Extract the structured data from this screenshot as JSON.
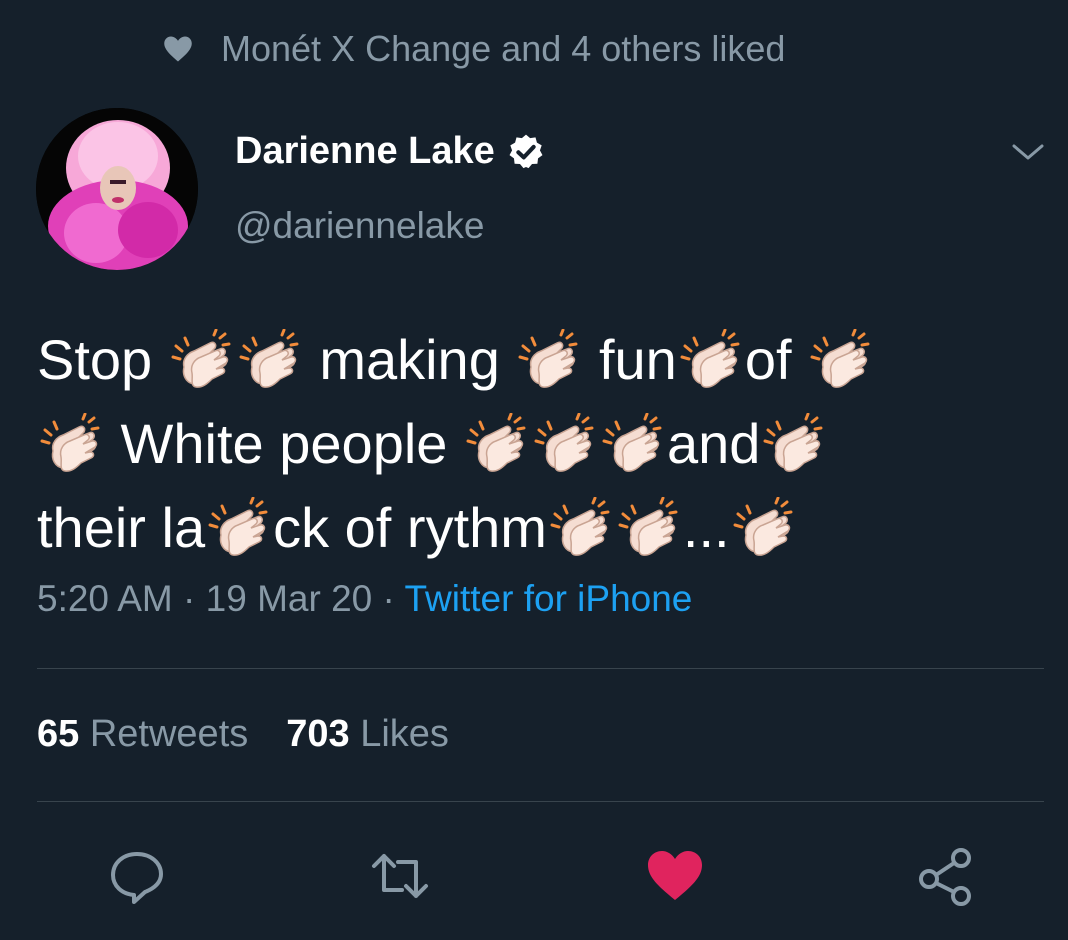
{
  "social_context": {
    "text": "Monét X Change and 4 others liked"
  },
  "author": {
    "name": "Darienne Lake",
    "handle": "@dariennelake"
  },
  "tweet": {
    "segments": [
      {
        "t": "text",
        "v": "Stop "
      },
      {
        "t": "clap"
      },
      {
        "t": "clap"
      },
      {
        "t": "text",
        "v": " making "
      },
      {
        "t": "clap"
      },
      {
        "t": "text",
        "v": " fun"
      },
      {
        "t": "clap"
      },
      {
        "t": "text",
        "v": "of "
      },
      {
        "t": "clap"
      },
      {
        "t": "br"
      },
      {
        "t": "clap"
      },
      {
        "t": "text",
        "v": " White people "
      },
      {
        "t": "clap"
      },
      {
        "t": "clap"
      },
      {
        "t": "clap"
      },
      {
        "t": "text",
        "v": "and"
      },
      {
        "t": "clap"
      },
      {
        "t": "br"
      },
      {
        "t": "text",
        "v": "their la"
      },
      {
        "t": "clap"
      },
      {
        "t": "text",
        "v": "ck of rythm"
      },
      {
        "t": "clap"
      },
      {
        "t": "clap"
      },
      {
        "t": "text",
        "v": "..."
      },
      {
        "t": "clap"
      }
    ]
  },
  "meta": {
    "time": "5:20 AM",
    "sep1": " · ",
    "date": "19 Mar 20",
    "sep2": " · ",
    "source": "Twitter for iPhone"
  },
  "stats": {
    "retweets_count": "65",
    "retweets_label": "Retweets",
    "likes_count": "703",
    "likes_label": "Likes"
  },
  "colors": {
    "background": "#15202b",
    "secondary_text": "#8899a6",
    "link": "#1da1f2",
    "like_active": "#e0245e"
  },
  "icons": [
    "heart-icon",
    "verified-badge-icon",
    "chevron-down-icon",
    "clapping-hands-icon",
    "reply-icon",
    "retweet-icon",
    "like-icon",
    "share-icon"
  ]
}
